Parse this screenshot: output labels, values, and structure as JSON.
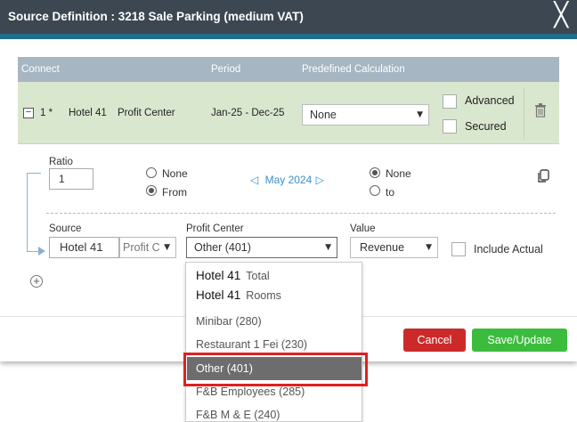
{
  "dialog": {
    "title": "Source Definition : 3218 Sale Parking (medium VAT)",
    "close_glyph": "╳"
  },
  "grid": {
    "headers": {
      "connect": "Connect",
      "period": "Period",
      "predefined": "Predefined Calculation"
    },
    "row": {
      "expand_glyph": "−",
      "number": "1 *",
      "hotel": "Hotel 41",
      "center": "Profit Center",
      "period": "Jan-25 - Dec-25",
      "calculation": "None",
      "advanced_label": "Advanced",
      "secured_label": "Secured"
    }
  },
  "ratio": {
    "label": "Ratio",
    "value": "1",
    "opt_none": "None",
    "opt_from": "From",
    "selected": "From"
  },
  "period_nav": {
    "prev": "◁",
    "label": "May 2024",
    "next": "▷"
  },
  "target": {
    "opt_none": "None",
    "opt_to": "to",
    "selected": "None"
  },
  "source": {
    "source_label": "Source",
    "source_hotel": "Hotel 41",
    "source_type": "Profit C",
    "profit_center_label": "Profit Center",
    "profit_center_value": "Other (401)",
    "value_label": "Value",
    "value_value": "Revenue",
    "include_actual_label": "Include Actual"
  },
  "buttons": {
    "cancel": "Cancel",
    "save": "Save/Update"
  },
  "dropdown": {
    "items": [
      {
        "main": "Hotel 41",
        "sub": "Total"
      },
      {
        "main": "Hotel 41",
        "sub": "Rooms"
      },
      {
        "label": "Minibar (280)"
      },
      {
        "label": "Restaurant 1 Fei (230)"
      },
      {
        "label": "Other (401)",
        "selected": true
      },
      {
        "label": "F&B Employees (285)"
      },
      {
        "label": "F&B M & E (240)"
      }
    ]
  },
  "colors": {
    "titlebar": "#3c4752",
    "accent_bar": "#1f6e8c",
    "header": "#a6b6c2",
    "row": "#dae7cf",
    "link": "#3a8fc8",
    "cancel": "#cc2a2a",
    "save": "#3cbc3c",
    "highlight": "#e02020"
  }
}
